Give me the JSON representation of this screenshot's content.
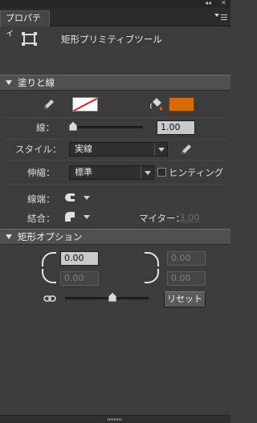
{
  "window": {
    "controls": [
      "◂◂",
      "✕"
    ],
    "tab_label": "プロパティ"
  },
  "tool": {
    "name": "矩形プリミティブツール",
    "icon": "rectangle-tool-icon"
  },
  "fill_stroke": {
    "header": "塗りと線",
    "stroke_icon": "pencil-icon",
    "fill_icon": "paint-bucket-icon",
    "stroke_color": "none",
    "fill_color": "#d86a00",
    "stroke_label": "線：",
    "stroke_value": "1.00",
    "stroke_slider_value": 1.0,
    "style_label": "スタイル：",
    "style_value": "実線",
    "scale_label": "伸縮：",
    "scale_value": "標準",
    "hinting_label": "ヒンティング",
    "hinting_checked": false,
    "cap_label": "線端：",
    "join_label": "結合：",
    "miter_label": "マイター：",
    "miter_value": "3.00"
  },
  "rect_options": {
    "header": "矩形オプション",
    "corner_tl": "0.00",
    "corner_tr": "0.00",
    "corner_bl": "0.00",
    "corner_br": "0.00",
    "link_icon": "link-icon",
    "reset_label": "リセット"
  },
  "colors": {
    "panel_bg": "#3c3c3c",
    "section_bg": "#505050",
    "fill_swatch": "#d86a00",
    "stroke_none_line": "#e02020"
  }
}
